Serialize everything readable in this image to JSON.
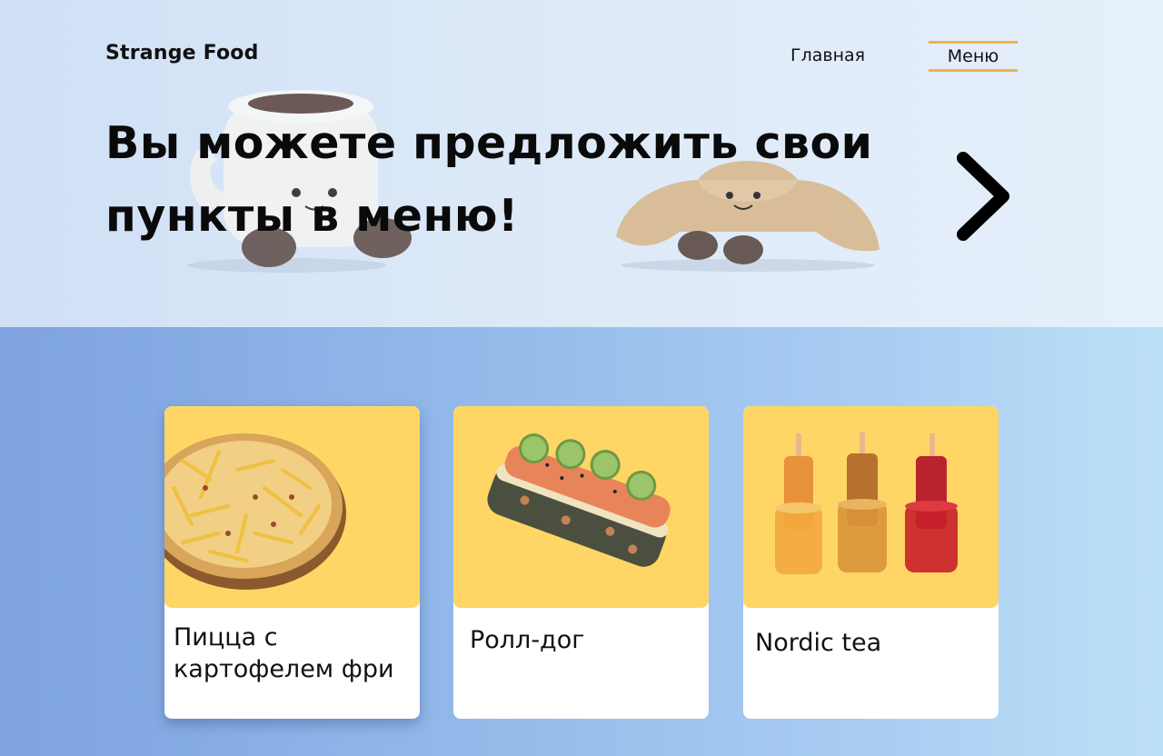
{
  "header": {
    "brand": "Strange Food",
    "nav": [
      {
        "label": "Главная",
        "active": false
      },
      {
        "label": "Меню",
        "active": true
      }
    ]
  },
  "hero": {
    "headline_line1": "Вы можете предложить свои",
    "headline_line2": "пункты в меню!",
    "next_icon": "chevron-right-icon"
  },
  "menu": {
    "cards": [
      {
        "title": "Пицца с картофелем фри",
        "image": "pizza-with-fries-image"
      },
      {
        "title": "Ролл-дог",
        "image": "roll-dog-image"
      },
      {
        "title": "Nordic tea",
        "image": "nordic-tea-image"
      }
    ]
  },
  "colors": {
    "accent": "#f3b04b",
    "card_image_bg": "#ffd666",
    "text": "#111111"
  }
}
